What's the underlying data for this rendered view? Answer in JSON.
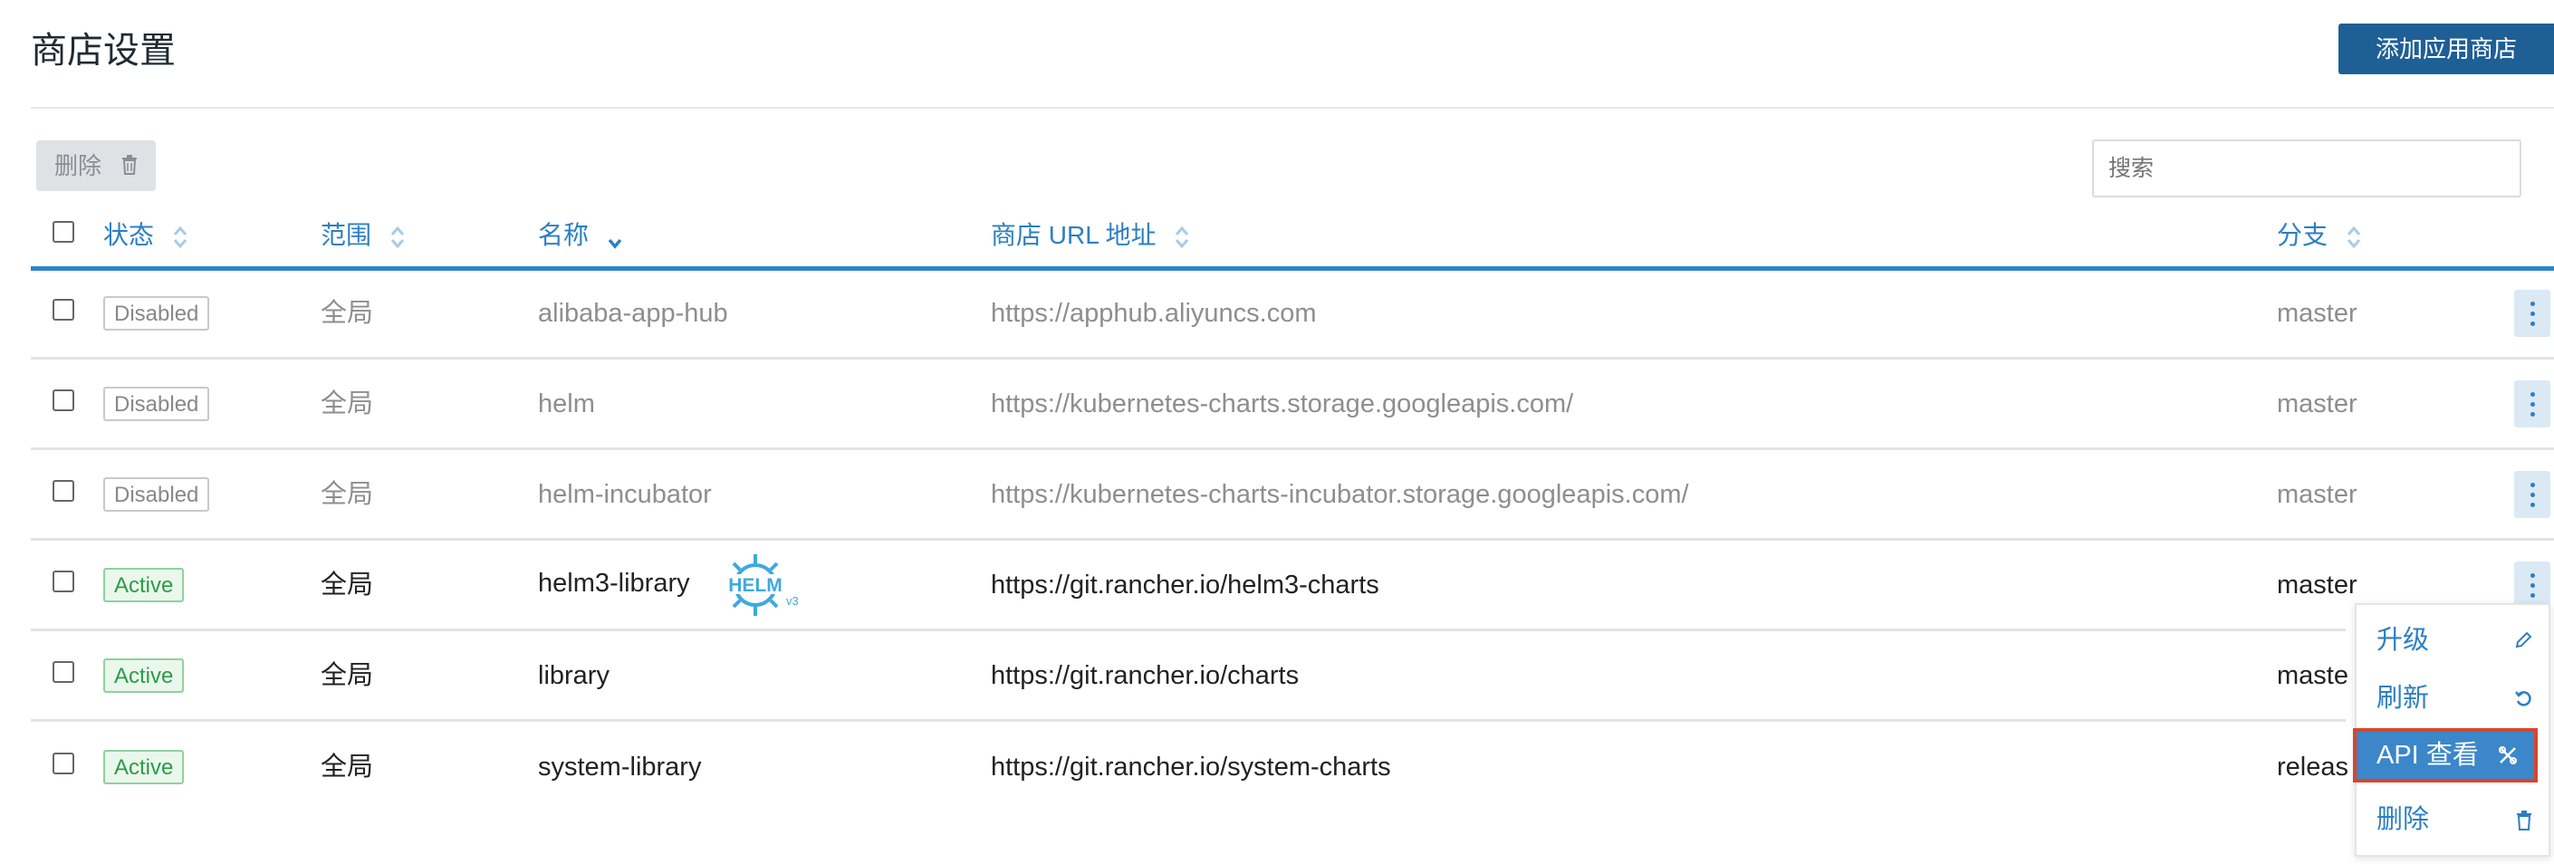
{
  "page": {
    "title": "商店设置",
    "add_button": "添加应用商店"
  },
  "toolbar": {
    "delete_label": "删除",
    "search_placeholder": "搜索"
  },
  "table": {
    "headers": {
      "state": "状态",
      "scope": "范围",
      "name": "名称",
      "url": "商店 URL 地址",
      "branch": "分支"
    },
    "rows": [
      {
        "state": "Disabled",
        "scope": "全局",
        "name": "alibaba-app-hub",
        "url": "https://apphub.aliyuncs.com",
        "branch": "master"
      },
      {
        "state": "Disabled",
        "scope": "全局",
        "name": "helm",
        "url": "https://kubernetes-charts.storage.googleapis.com/",
        "branch": "master"
      },
      {
        "state": "Disabled",
        "scope": "全局",
        "name": "helm-incubator",
        "url": "https://kubernetes-charts-incubator.storage.googleapis.com/",
        "branch": "master"
      },
      {
        "state": "Active",
        "scope": "全局",
        "name": "helm3-library",
        "url": "https://git.rancher.io/helm3-charts",
        "branch": "master",
        "badge": "HELM",
        "badge_sub": "v3"
      },
      {
        "state": "Active",
        "scope": "全局",
        "name": "library",
        "url": "https://git.rancher.io/charts",
        "branch": "maste"
      },
      {
        "state": "Active",
        "scope": "全局",
        "name": "system-library",
        "url": "https://git.rancher.io/system-charts",
        "branch": "releas"
      }
    ]
  },
  "action_menu": {
    "items": [
      {
        "label": "升级",
        "icon": "pencil-icon"
      },
      {
        "label": "刷新",
        "icon": "refresh-icon"
      },
      {
        "label": "API 查看",
        "icon": "api-icon"
      },
      {
        "label": "删除",
        "icon": "trash-icon"
      }
    ],
    "selected_index": 2
  },
  "colors": {
    "primary": "#1e5f96",
    "link": "#2c7fc3",
    "active_green": "#2e9a48",
    "highlight_border": "#d9452d"
  }
}
